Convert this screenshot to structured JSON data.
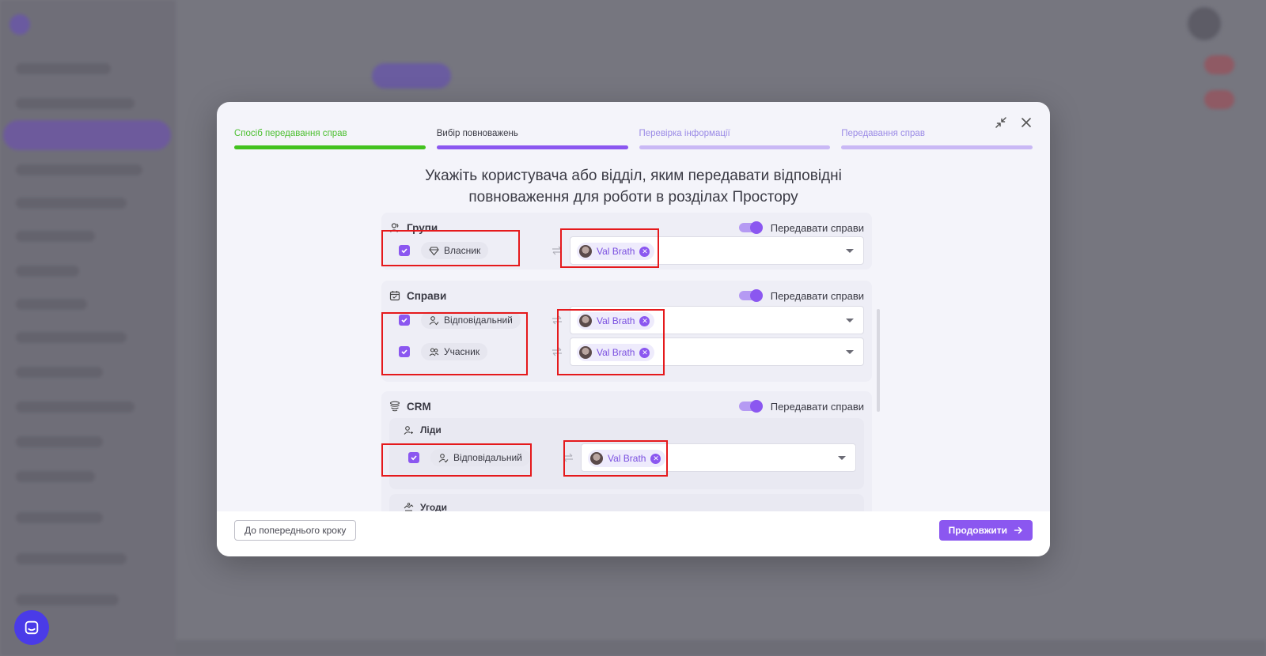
{
  "wizard": {
    "steps": [
      {
        "label": "Спосіб передавання справ",
        "state": "done"
      },
      {
        "label": "Вибір повноважень",
        "state": "current"
      },
      {
        "label": "Перевірка інформації",
        "state": "todo"
      },
      {
        "label": "Передавання справ",
        "state": "todo"
      }
    ],
    "heading_line1": "Укажіть користувача або відділ, яким передавати відповідні",
    "heading_line2": "повноваження для роботи в розділах Простору"
  },
  "sections": {
    "groups": {
      "title": "Групи",
      "toggle_label": "Передавати справи",
      "rows": [
        {
          "role": "Власник",
          "assignee": "Val Brath",
          "checked": true
        }
      ]
    },
    "tasks": {
      "title": "Справи",
      "toggle_label": "Передавати справи",
      "rows": [
        {
          "role": "Відповідальний",
          "assignee": "Val Brath",
          "checked": true
        },
        {
          "role": "Учасник",
          "assignee": "Val Brath",
          "checked": true
        }
      ]
    },
    "crm": {
      "title": "CRM",
      "toggle_label": "Передавати справи",
      "leads": {
        "title": "Ліди",
        "rows": [
          {
            "role": "Відповідальний",
            "assignee": "Val Brath",
            "checked": true
          }
        ]
      },
      "deals": {
        "title": "Угоди"
      }
    }
  },
  "footer": {
    "back_label": "До попереднього кроку",
    "next_label": "Продовжити"
  },
  "colors": {
    "accent": "#8b57f0",
    "done": "#43c21f",
    "highlight": "#e5191c"
  }
}
